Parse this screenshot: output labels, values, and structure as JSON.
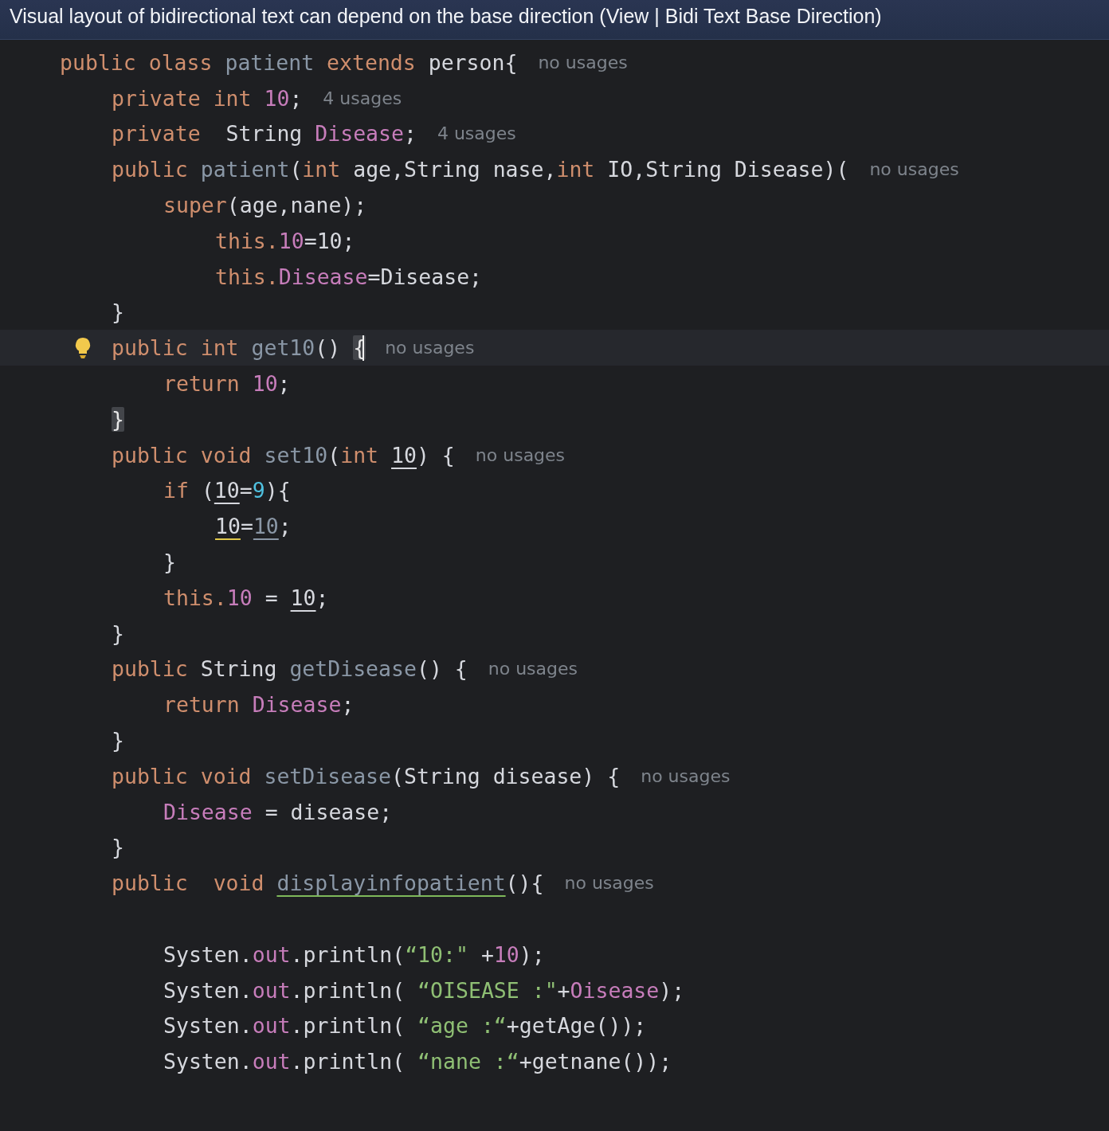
{
  "banner": {
    "text": "Visual layout of bidirectional text can depend on the base direction (View | Bidi Text Base Direction)"
  },
  "editor": {
    "lines": [
      {
        "current": false,
        "tokens": [
          {
            "kind": "keyword",
            "text": "public olass "
          },
          {
            "kind": "method",
            "text": "patient "
          },
          {
            "kind": "keyword",
            "text": "extends "
          },
          {
            "kind": "plain",
            "text": "person{"
          },
          {
            "kind": "hint",
            "text": "no usages"
          }
        ],
        "children": [
          {
            "current": false,
            "tokens": [
              {
                "kind": "keyword",
                "text": "private int "
              },
              {
                "kind": "field",
                "text": "10"
              },
              {
                "kind": "plain",
                "text": ";"
              },
              {
                "kind": "hint",
                "text": "4 usages"
              }
            ]
          },
          {
            "current": false,
            "tokens": [
              {
                "kind": "keyword",
                "text": "private  "
              },
              {
                "kind": "plain",
                "text": "String "
              },
              {
                "kind": "field",
                "text": "Disease"
              },
              {
                "kind": "plain",
                "text": ";"
              },
              {
                "kind": "hint",
                "text": "4 usages"
              }
            ]
          },
          {
            "current": false,
            "tokens": [
              {
                "kind": "keyword",
                "text": "public "
              },
              {
                "kind": "method",
                "text": "patient"
              },
              {
                "kind": "plain",
                "text": "("
              },
              {
                "kind": "keyword",
                "text": "int "
              },
              {
                "kind": "plain",
                "text": "age,String nase,"
              },
              {
                "kind": "keyword",
                "text": "int "
              },
              {
                "kind": "plain",
                "text": "IO,String Disease)("
              },
              {
                "kind": "hint",
                "text": "no usages"
              }
            ],
            "children": [
              {
                "current": false,
                "tokens": [
                  {
                    "kind": "keyword",
                    "text": "super"
                  },
                  {
                    "kind": "plain",
                    "text": "(age,nane);"
                  }
                ],
                "children": [
                  {
                    "current": false,
                    "tokens": [
                      {
                        "kind": "keyword",
                        "text": "this."
                      },
                      {
                        "kind": "field",
                        "text": "10"
                      },
                      {
                        "kind": "plain",
                        "text": "=10;"
                      }
                    ]
                  },
                  {
                    "current": false,
                    "tokens": [
                      {
                        "kind": "keyword",
                        "text": "this."
                      },
                      {
                        "kind": "field",
                        "text": "Disease"
                      },
                      {
                        "kind": "plain",
                        "text": "=Disease;"
                      }
                    ]
                  }
                ]
              }
            ]
          },
          {
            "current": false,
            "tokens": [
              {
                "kind": "plain",
                "text": "}"
              }
            ]
          },
          {
            "current": true,
            "tokens": [
              {
                "kind": "keyword",
                "text": "public int "
              },
              {
                "kind": "method",
                "text": "get10"
              },
              {
                "kind": "plain",
                "text": "() "
              },
              {
                "kind": "bracket",
                "text": "{"
              },
              {
                "kind": "hint",
                "text": "no usages"
              }
            ],
            "children": [
              {
                "current": false,
                "tokens": [
                  {
                    "kind": "keyword",
                    "text": "return "
                  },
                  {
                    "kind": "field",
                    "text": "10"
                  },
                  {
                    "kind": "plain",
                    "text": ";"
                  }
                ]
              }
            ]
          },
          {
            "current": false,
            "tokens": [
              {
                "kind": "bracket",
                "text": "}"
              }
            ]
          },
          {
            "current": false,
            "tokens": [
              {
                "kind": "keyword",
                "text": "public void "
              },
              {
                "kind": "method",
                "text": "set10"
              },
              {
                "kind": "plain",
                "text": "("
              },
              {
                "kind": "keyword",
                "text": "int "
              },
              {
                "kind": "param",
                "text": "10"
              },
              {
                "kind": "plain",
                "text": ") {"
              },
              {
                "kind": "hint",
                "text": "no usages"
              }
            ],
            "children": [
              {
                "current": false,
                "tokens": [
                  {
                    "kind": "keyword",
                    "text": "if "
                  },
                  {
                    "kind": "plain",
                    "text": "("
                  },
                  {
                    "kind": "param",
                    "text": "10"
                  },
                  {
                    "kind": "plain",
                    "text": "="
                  },
                  {
                    "kind": "number",
                    "text": "9"
                  },
                  {
                    "kind": "plain",
                    "text": "){"
                  }
                ],
                "children": [
                  {
                    "current": false,
                    "tokens": [
                      {
                        "kind": "param-warn",
                        "text": "10"
                      },
                      {
                        "kind": "plain",
                        "text": "="
                      },
                      {
                        "kind": "param-dim",
                        "text": "10"
                      },
                      {
                        "kind": "plain",
                        "text": ";"
                      }
                    ]
                  }
                ]
              },
              {
                "current": false,
                "tokens": [
                  {
                    "kind": "plain",
                    "text": "}"
                  }
                ]
              },
              {
                "current": false,
                "tokens": [
                  {
                    "kind": "keyword",
                    "text": "this."
                  },
                  {
                    "kind": "field",
                    "text": "10"
                  },
                  {
                    "kind": "plain",
                    "text": " = "
                  },
                  {
                    "kind": "param",
                    "text": "10"
                  },
                  {
                    "kind": "plain",
                    "text": ";"
                  }
                ]
              }
            ]
          },
          {
            "current": false,
            "tokens": [
              {
                "kind": "plain",
                "text": "}"
              }
            ]
          },
          {
            "current": false,
            "tokens": [
              {
                "kind": "keyword",
                "text": "public "
              },
              {
                "kind": "plain",
                "text": "String "
              },
              {
                "kind": "method",
                "text": "getDisease"
              },
              {
                "kind": "plain",
                "text": "() {"
              },
              {
                "kind": "hint",
                "text": "no usages"
              }
            ],
            "children": [
              {
                "current": false,
                "tokens": [
                  {
                    "kind": "keyword",
                    "text": "return "
                  },
                  {
                    "kind": "field",
                    "text": "Disease"
                  },
                  {
                    "kind": "plain",
                    "text": ";"
                  }
                ]
              }
            ]
          },
          {
            "current": false,
            "tokens": [
              {
                "kind": "plain",
                "text": "}"
              }
            ]
          },
          {
            "current": false,
            "tokens": [
              {
                "kind": "keyword",
                "text": "public void "
              },
              {
                "kind": "method",
                "text": "setDisease"
              },
              {
                "kind": "plain",
                "text": "(String disease) {"
              },
              {
                "kind": "hint",
                "text": "no usages"
              }
            ],
            "children": [
              {
                "current": false,
                "tokens": [
                  {
                    "kind": "field",
                    "text": "Disease"
                  },
                  {
                    "kind": "plain",
                    "text": " = disease;"
                  }
                ]
              }
            ]
          },
          {
            "current": false,
            "tokens": [
              {
                "kind": "plain",
                "text": "}"
              }
            ]
          },
          {
            "current": false,
            "tokens": [
              {
                "kind": "keyword",
                "text": "public  void "
              },
              {
                "kind": "method-warn",
                "text": "displayinfopatient"
              },
              {
                "kind": "plain",
                "text": "(){"
              },
              {
                "kind": "hint",
                "text": "no usages"
              }
            ],
            "children": [
              {
                "current": false
              },
              {
                "current": false,
                "tokens": [
                  {
                    "kind": "plain",
                    "text": "Systen."
                  },
                  {
                    "kind": "field",
                    "text": "out"
                  },
                  {
                    "kind": "plain",
                    "text": ".println("
                  },
                  {
                    "kind": "string",
                    "text": "“10:\" "
                  },
                  {
                    "kind": "plain",
                    "text": "+"
                  },
                  {
                    "kind": "field",
                    "text": "10"
                  },
                  {
                    "kind": "plain",
                    "text": ");"
                  }
                ]
              },
              {
                "current": false,
                "tokens": [
                  {
                    "kind": "plain",
                    "text": "Systen."
                  },
                  {
                    "kind": "field",
                    "text": "out"
                  },
                  {
                    "kind": "plain",
                    "text": ".println( "
                  },
                  {
                    "kind": "string",
                    "text": "“OISEASE :\""
                  },
                  {
                    "kind": "plain",
                    "text": "+"
                  },
                  {
                    "kind": "field",
                    "text": "Oisease"
                  },
                  {
                    "kind": "plain",
                    "text": ");"
                  }
                ]
              },
              {
                "current": false,
                "tokens": [
                  {
                    "kind": "plain",
                    "text": "Systen."
                  },
                  {
                    "kind": "field",
                    "text": "out"
                  },
                  {
                    "kind": "plain",
                    "text": ".println( "
                  },
                  {
                    "kind": "string",
                    "text": "“age :“"
                  },
                  {
                    "kind": "plain",
                    "text": "+getAge());"
                  }
                ]
              },
              {
                "current": false,
                "tokens": [
                  {
                    "kind": "plain",
                    "text": "Systen."
                  },
                  {
                    "kind": "field",
                    "text": "out"
                  },
                  {
                    "kind": "plain",
                    "text": ".println( "
                  },
                  {
                    "kind": "string",
                    "text": "“nane :“"
                  },
                  {
                    "kind": "plain",
                    "text": "+getnane());"
                  }
                ]
              }
            ]
          }
        ]
      }
    ]
  }
}
